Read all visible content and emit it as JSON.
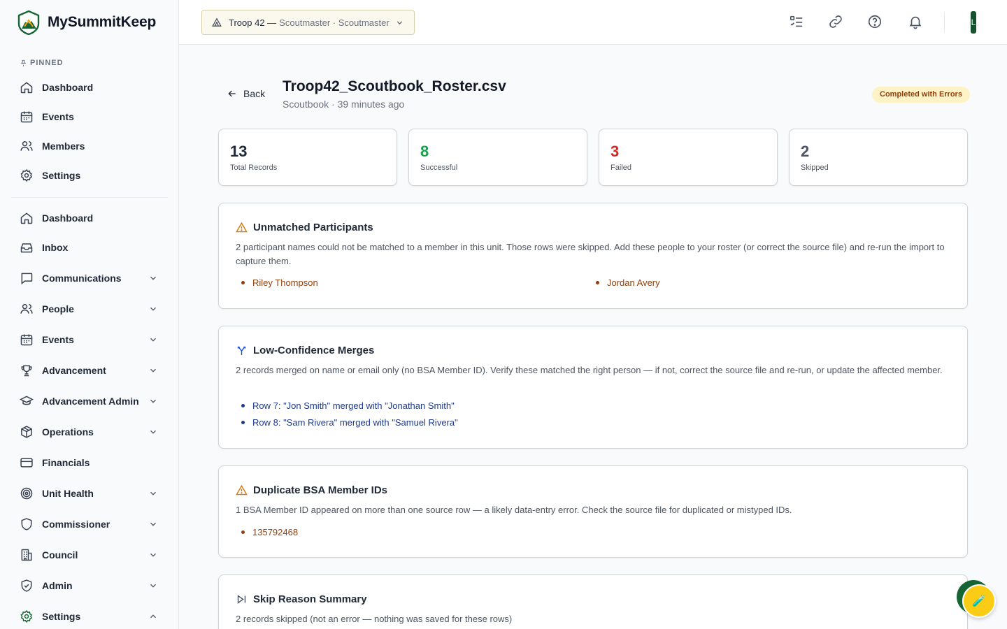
{
  "brand": {
    "name": "MySummitKeep"
  },
  "sidebar": {
    "pinned_label": "PINNED",
    "pinned": [
      {
        "label": "Dashboard",
        "icon": "home-icon"
      },
      {
        "label": "Events",
        "icon": "calendar-icon"
      },
      {
        "label": "Members",
        "icon": "users-icon"
      },
      {
        "label": "Settings",
        "icon": "gear-icon"
      }
    ],
    "items": [
      {
        "label": "Dashboard",
        "icon": "home-icon",
        "expandable": false
      },
      {
        "label": "Inbox",
        "icon": "inbox-icon",
        "expandable": false
      },
      {
        "label": "Communications",
        "icon": "chat-icon",
        "expandable": true
      },
      {
        "label": "People",
        "icon": "users-icon",
        "expandable": true
      },
      {
        "label": "Events",
        "icon": "calendar-icon",
        "expandable": true
      },
      {
        "label": "Advancement",
        "icon": "trophy-icon",
        "expandable": true
      },
      {
        "label": "Advancement Admin",
        "icon": "graduation-cap-icon",
        "expandable": true
      },
      {
        "label": "Operations",
        "icon": "box-icon",
        "expandable": true
      },
      {
        "label": "Financials",
        "icon": "credit-card-icon",
        "expandable": false
      },
      {
        "label": "Unit Health",
        "icon": "target-icon",
        "expandable": true
      },
      {
        "label": "Commissioner",
        "icon": "shield-icon",
        "expandable": true
      },
      {
        "label": "Council",
        "icon": "building-icon",
        "expandable": true
      },
      {
        "label": "Admin",
        "icon": "shield-check-icon",
        "expandable": true
      },
      {
        "label": "Settings",
        "icon": "gear-icon",
        "expandable": true,
        "expanded": true
      }
    ]
  },
  "topbar": {
    "unit_name": "Troop 42 —",
    "unit_role": "Scoutmaster · Scoutmaster",
    "avatar_initial": "L"
  },
  "page": {
    "back_label": "Back",
    "file_name": "Troop42_Scoutbook_Roster.csv",
    "file_meta": "Scoutbook · 39 minutes ago",
    "status": "Completed with Errors",
    "status_color": "#fef3c7"
  },
  "stats": [
    {
      "value": "13",
      "label": "Total Records",
      "color": "#1f2937"
    },
    {
      "value": "8",
      "label": "Successful",
      "color": "#16a34a"
    },
    {
      "value": "3",
      "label": "Failed",
      "color": "#dc2626"
    },
    {
      "value": "2",
      "label": "Skipped",
      "color": "#4b5563"
    }
  ],
  "unmatched": {
    "title": "Unmatched Participants",
    "description": "2 participant names could not be matched to a member in this unit. Those rows were skipped. Add these people to your roster (or correct the source file) and re-run the import to capture them.",
    "names": [
      "Riley Thompson",
      "Jordan Avery"
    ]
  },
  "merges": {
    "title": "Low-Confidence Merges",
    "description": "2 records merged on name or email only (no BSA Member ID). Verify these matched the right person — if not, correct the source file and re-run, or update the affected member.",
    "rows": [
      "Row 7: \"Jon Smith\" merged with \"Jonathan Smith\"",
      "Row 8: \"Sam Rivera\" merged with \"Samuel Rivera\""
    ]
  },
  "duplicates": {
    "title": "Duplicate BSA Member IDs",
    "description": "1 BSA Member ID appeared on more than one source row — a likely data-entry error. Check the source file for duplicated or mistyped IDs.",
    "ids": [
      "135792468"
    ]
  },
  "skips": {
    "title": "Skip Reason Summary",
    "description": "2 records skipped (not an error — nothing was saved for these rows)"
  }
}
